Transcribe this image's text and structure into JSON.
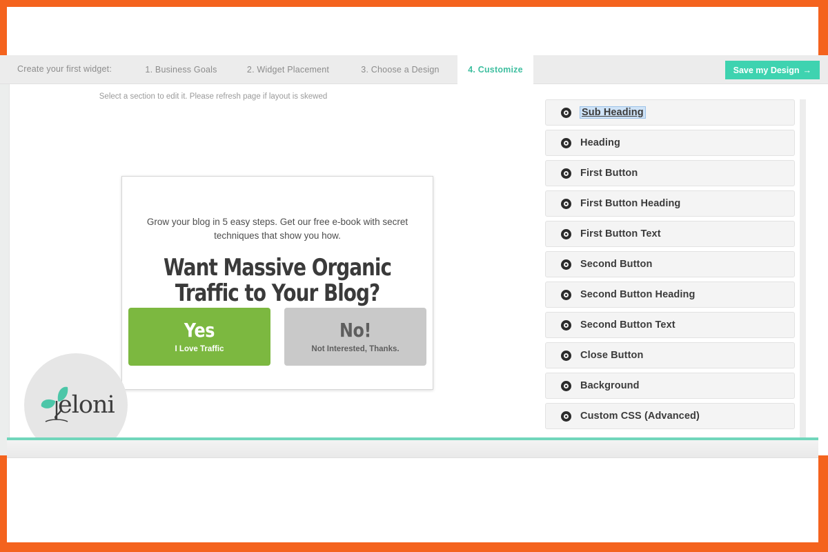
{
  "theme": {
    "frame_color": "#f4631e",
    "accent_teal": "#3ed3b0",
    "active_tab_color": "#3fbfa0",
    "yes_button_color": "#7cb840",
    "no_button_color": "#c9c9c9",
    "rule_color": "#71d6bb"
  },
  "tabbar": {
    "label": "Create your first widget:",
    "tabs": [
      {
        "label": "1. Business Goals",
        "active": false
      },
      {
        "label": "2. Widget Placement",
        "active": false
      },
      {
        "label": "3. Choose a Design",
        "active": false
      },
      {
        "label": "4. Customize",
        "active": true
      }
    ],
    "save_button": "Save my Design",
    "save_button_arrow": "→"
  },
  "preview": {
    "hint": "Select a section to edit it. Please refresh page if layout is skewed",
    "widget": {
      "sub_heading": "Grow your blog in 5 easy steps. Get our free e-book with secret techniques that show you how.",
      "heading": "Want Massive Organic Traffic to Your Blog?",
      "first_button": {
        "heading": "Yes",
        "text": "I Love Traffic"
      },
      "second_button": {
        "heading": "No!",
        "text": "Not Interested, Thanks."
      }
    }
  },
  "logo": {
    "text": "eloni",
    "full_name": "Yeloni",
    "icon": "sprout-leaf-icon"
  },
  "options_panel": {
    "items": [
      {
        "label": "Sub Heading",
        "selected": true
      },
      {
        "label": "Heading",
        "selected": false
      },
      {
        "label": "First Button",
        "selected": false
      },
      {
        "label": "First Button Heading",
        "selected": false
      },
      {
        "label": "First Button Text",
        "selected": false
      },
      {
        "label": "Second Button",
        "selected": false
      },
      {
        "label": "Second Button Heading",
        "selected": false
      },
      {
        "label": "Second Button Text",
        "selected": false
      },
      {
        "label": "Close Button",
        "selected": false
      },
      {
        "label": "Background",
        "selected": false
      },
      {
        "label": "Custom CSS (Advanced)",
        "selected": false
      }
    ]
  }
}
